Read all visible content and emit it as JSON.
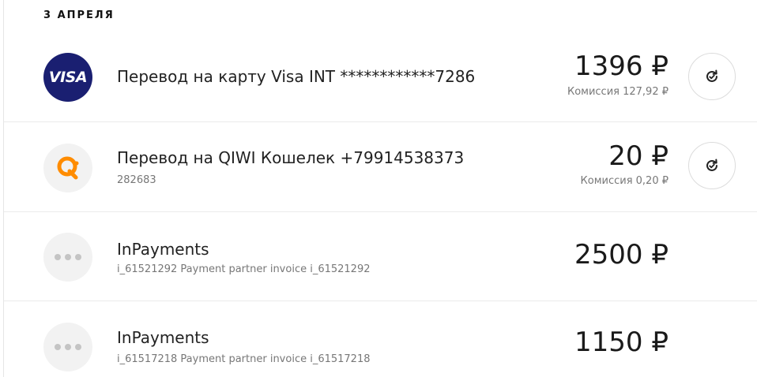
{
  "date_header": "3 АПРЕЛЯ",
  "transactions": [
    {
      "icon": "visa-logo",
      "logo_text": "VISA",
      "title": "Перевод на карту Visa INT ************7286",
      "amount": "1396 ₽",
      "commission": "Комиссия 127,92 ₽",
      "repeat_icon": "repeat-icon"
    },
    {
      "icon": "qiwi-logo",
      "title": "Перевод на QIWI Кошелек +79914538373",
      "subtitle": "282683",
      "amount": "20 ₽",
      "commission": "Комиссия 0,20 ₽",
      "repeat_icon": "repeat-icon"
    },
    {
      "icon": "more-dots-icon",
      "title": "InPayments",
      "subtitle": "i_61521292 Payment partner invoice i_61521292",
      "amount": "2500 ₽"
    },
    {
      "icon": "more-dots-icon",
      "title": "InPayments",
      "subtitle": "i_61517218 Payment partner invoice i_61517218",
      "amount": "1150 ₽"
    }
  ],
  "colors": {
    "visa_brand": "#1a1f71",
    "qiwi_orange": "#ff8c00",
    "placeholder_bg": "#f2f2f2"
  }
}
